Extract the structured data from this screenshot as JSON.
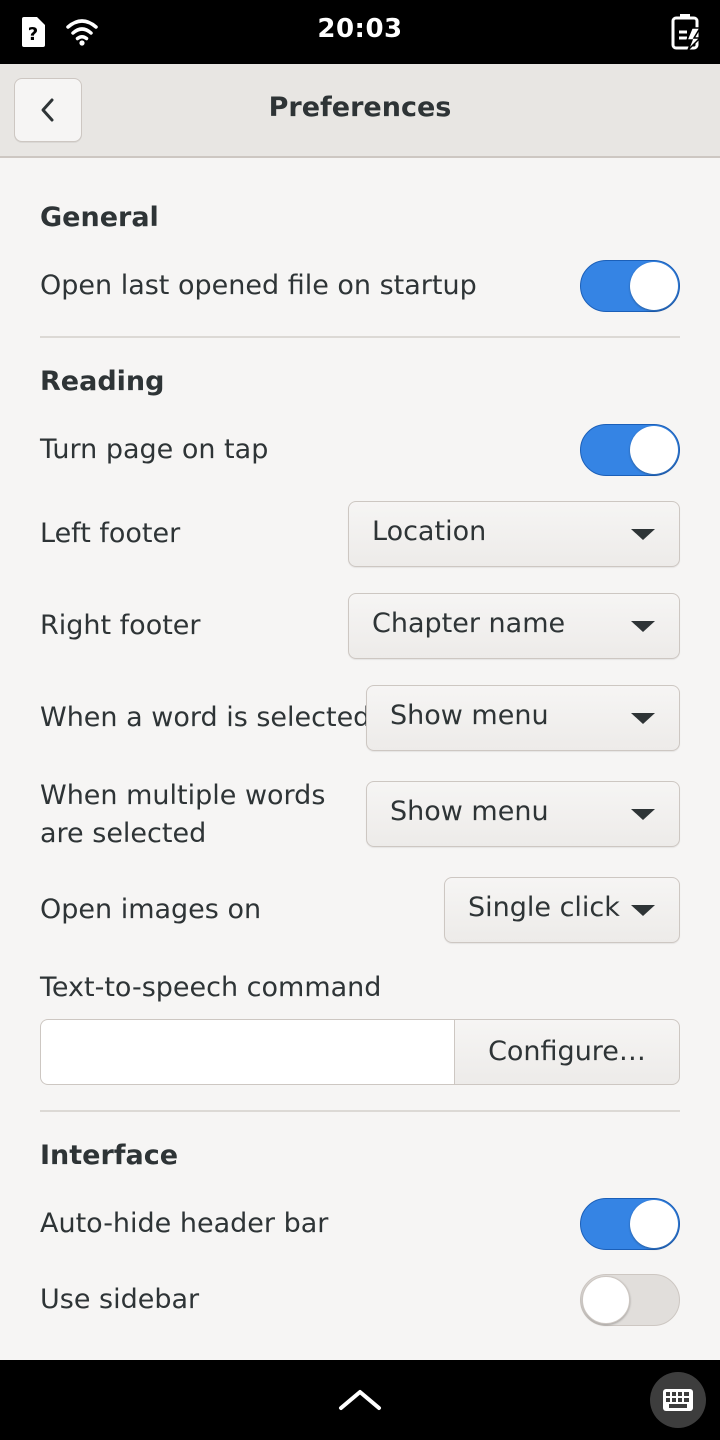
{
  "status_bar": {
    "time": "20:03"
  },
  "header": {
    "title": "Preferences"
  },
  "sections": {
    "general": {
      "title": "General",
      "open_last_file": {
        "label": "Open last opened file on startup",
        "enabled": true
      }
    },
    "reading": {
      "title": "Reading",
      "turn_page_on_tap": {
        "label": "Turn page on tap",
        "enabled": true
      },
      "left_footer": {
        "label": "Left footer",
        "value": "Location"
      },
      "right_footer": {
        "label": "Right footer",
        "value": "Chapter name"
      },
      "word_selected": {
        "label": "When a word is selected",
        "value": "Show menu"
      },
      "multiple_words_selected": {
        "label_line1": "When multiple words",
        "label_line2": "are selected",
        "value": "Show menu"
      },
      "open_images_on": {
        "label": "Open images on",
        "value": "Single click"
      },
      "tts": {
        "label": "Text-to-speech command",
        "value": "",
        "button_label": "Configure…"
      }
    },
    "interface": {
      "title": "Interface",
      "auto_hide_header": {
        "label": "Auto-hide header bar",
        "enabled": true
      },
      "use_sidebar": {
        "label": "Use sidebar",
        "enabled": false
      }
    }
  },
  "icons": {
    "sim": "sim-unknown-icon",
    "wifi": "wifi-icon",
    "battery": "battery-charging-icon",
    "back": "chevron-left-icon",
    "home": "chevron-up-icon",
    "keyboard": "keyboard-icon"
  },
  "colors": {
    "accent": "#3584e4",
    "background": "#f6f5f4",
    "header": "#e8e6e3"
  }
}
